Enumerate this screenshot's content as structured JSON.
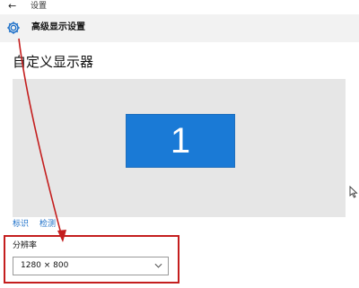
{
  "window": {
    "title": "设置",
    "back_icon": "back-arrow-icon"
  },
  "header": {
    "icon": "gear-icon",
    "title": "高级显示设置"
  },
  "page": {
    "title": "自定义显示器"
  },
  "preview": {
    "monitor_label": "1",
    "monitor_color": "#1a7ad6",
    "background": "#e6e6e6"
  },
  "links": {
    "identify": "标识",
    "detect": "检测"
  },
  "resolution": {
    "label": "分辨率",
    "value": "1280 × 800",
    "dropdown_icon": "chevron-down-icon"
  },
  "annotation": {
    "color": "#c41e1e",
    "arrow_icon": "red-arrow-annotation",
    "highlight": "red-highlight-box"
  }
}
